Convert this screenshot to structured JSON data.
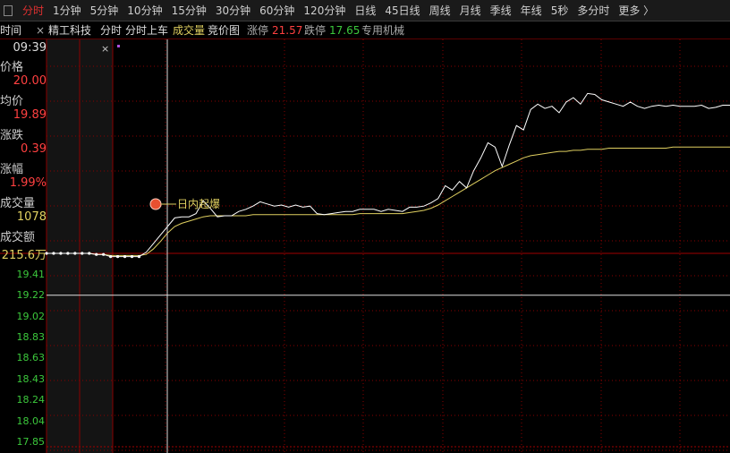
{
  "tabs": [
    {
      "label": "分时",
      "active": true
    },
    {
      "label": "1分钟"
    },
    {
      "label": "5分钟"
    },
    {
      "label": "10分钟"
    },
    {
      "label": "15分钟"
    },
    {
      "label": "30分钟"
    },
    {
      "label": "60分钟"
    },
    {
      "label": "120分钟"
    },
    {
      "label": "日线"
    },
    {
      "label": "45日线"
    },
    {
      "label": "周线"
    },
    {
      "label": "月线"
    },
    {
      "label": "季线"
    },
    {
      "label": "年线"
    },
    {
      "label": "5秒"
    },
    {
      "label": "多分时"
    },
    {
      "label": "更多 〉"
    }
  ],
  "infobar": {
    "time_label": "时间",
    "close_x": "×",
    "stock_name": "精工科技",
    "mode_label": "分时",
    "mode2_label": "分时上车",
    "volume_label": "成交量",
    "auction_label": "竞价图",
    "limit_up_label": "涨停",
    "limit_up_value": "21.57",
    "limit_down_label": "跌停",
    "limit_down_value": "17.65",
    "sector": "专用机械"
  },
  "crosshair_info": {
    "time": "09:39",
    "price_label": "价格",
    "price": "20.00",
    "avg_label": "均价",
    "avg": "19.89",
    "change_label": "涨跌",
    "change": "0.39",
    "pct_label": "涨幅",
    "pct": "1.99%",
    "vol_label": "成交量",
    "vol": "1078",
    "amount_label": "成交额",
    "amount": "215.6万",
    "close_x": "×"
  },
  "event_marker": {
    "label": "日内起爆"
  },
  "colors": {
    "up": "#ff4040",
    "down": "#3cc83c",
    "price_line": "#ffffff",
    "avg_line": "#e0d060",
    "grid": "#8a0000",
    "crosshair": "#dddddd"
  },
  "chart_data": {
    "type": "line",
    "price_axis_labels": [
      "19.41",
      "19.22",
      "19.02",
      "18.83",
      "18.63",
      "18.43",
      "18.24",
      "18.04",
      "17.85"
    ],
    "price_axis_values": [
      19.41,
      19.22,
      19.02,
      18.83,
      18.63,
      18.43,
      18.24,
      18.04,
      17.85
    ],
    "ylim": [
      17.75,
      21.57
    ],
    "reference_price": 19.61,
    "series": [
      {
        "key": "price",
        "values": [
          19.61,
          19.61,
          19.61,
          19.61,
          19.61,
          19.61,
          19.61,
          19.6,
          19.6,
          19.58,
          19.58,
          19.58,
          19.58,
          19.58,
          19.62,
          19.7,
          19.78,
          19.86,
          19.94,
          19.95,
          19.95,
          19.98,
          20.1,
          20.03,
          19.95,
          19.96,
          19.96,
          20.0,
          20.02,
          20.05,
          20.09,
          20.07,
          20.05,
          20.06,
          20.04,
          20.06,
          20.04,
          20.05,
          19.98,
          19.97,
          19.98,
          19.99,
          20.0,
          20.0,
          20.02,
          20.02,
          20.02,
          20.0,
          20.02,
          20.01,
          20.0,
          20.04,
          20.04,
          20.05,
          20.08,
          20.12,
          20.24,
          20.2,
          20.28,
          20.22,
          20.38,
          20.5,
          20.64,
          20.6,
          20.42,
          20.62,
          20.8,
          20.76,
          20.95,
          21.0,
          20.96,
          20.98,
          20.92,
          21.02,
          21.06,
          21.0,
          21.1,
          21.09,
          21.04,
          21.02,
          21.0,
          20.98,
          21.02,
          20.98,
          20.96,
          20.98,
          20.99,
          20.98,
          20.99,
          20.98,
          20.98,
          20.98,
          20.99,
          20.96,
          20.97,
          20.99,
          20.99
        ]
      },
      {
        "key": "avg",
        "values": [
          19.61,
          19.61,
          19.61,
          19.61,
          19.61,
          19.61,
          19.61,
          19.6,
          19.6,
          19.59,
          19.59,
          19.59,
          19.59,
          19.59,
          19.6,
          19.65,
          19.72,
          19.8,
          19.86,
          19.89,
          19.91,
          19.93,
          19.95,
          19.96,
          19.96,
          19.96,
          19.96,
          19.96,
          19.96,
          19.97,
          19.97,
          19.97,
          19.97,
          19.97,
          19.97,
          19.97,
          19.97,
          19.97,
          19.97,
          19.97,
          19.97,
          19.97,
          19.97,
          19.97,
          19.98,
          19.98,
          19.98,
          19.98,
          19.98,
          19.98,
          19.98,
          19.99,
          20.0,
          20.01,
          20.03,
          20.06,
          20.1,
          20.14,
          20.18,
          20.22,
          20.26,
          20.3,
          20.34,
          20.38,
          20.41,
          20.44,
          20.47,
          20.5,
          20.52,
          20.53,
          20.54,
          20.55,
          20.56,
          20.56,
          20.57,
          20.57,
          20.58,
          20.58,
          20.58,
          20.59,
          20.59,
          20.59,
          20.59,
          20.59,
          20.59,
          20.59,
          20.59,
          20.59,
          20.6,
          20.6,
          20.6,
          20.6,
          20.6,
          20.6,
          20.6,
          20.6,
          20.6
        ]
      }
    ]
  }
}
